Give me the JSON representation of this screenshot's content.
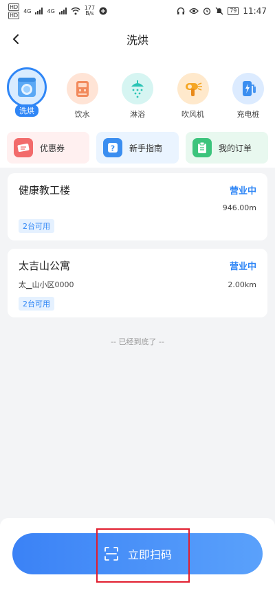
{
  "status_bar": {
    "sim1": "HD",
    "sim2": "HD",
    "net1": "4G",
    "net2": "4G",
    "speed_value": "177",
    "speed_unit": "B/s",
    "battery": "79",
    "time": "11:47"
  },
  "nav": {
    "title": "洗烘"
  },
  "categories": [
    {
      "label": "洗烘",
      "icon": "washing-machine-icon",
      "active": true
    },
    {
      "label": "饮水",
      "icon": "water-dispenser-icon"
    },
    {
      "label": "淋浴",
      "icon": "shower-icon"
    },
    {
      "label": "吹风机",
      "icon": "hair-dryer-icon"
    },
    {
      "label": "充电桩",
      "icon": "charging-station-icon"
    }
  ],
  "quick_links": [
    {
      "label": "优惠券",
      "icon": "coupon-icon"
    },
    {
      "label": "新手指南",
      "icon": "help-icon"
    },
    {
      "label": "我的订单",
      "icon": "order-icon"
    }
  ],
  "stores": [
    {
      "name": "健康教工楼",
      "status": "营业中",
      "address": "",
      "distance": "946.00m",
      "available": "2台可用"
    },
    {
      "name": "太吉山公寓",
      "status": "营业中",
      "address": "太▁山小区0000",
      "distance": "2.00km",
      "available": "2台可用"
    }
  ],
  "list_end": "-- 已经到底了 --",
  "scan_button": {
    "label": "立即扫码",
    "icon": "scan-icon"
  },
  "colors": {
    "primary": "#2f86f6",
    "highlight_box": "#e11d2e",
    "background": "#f3f4f6"
  }
}
